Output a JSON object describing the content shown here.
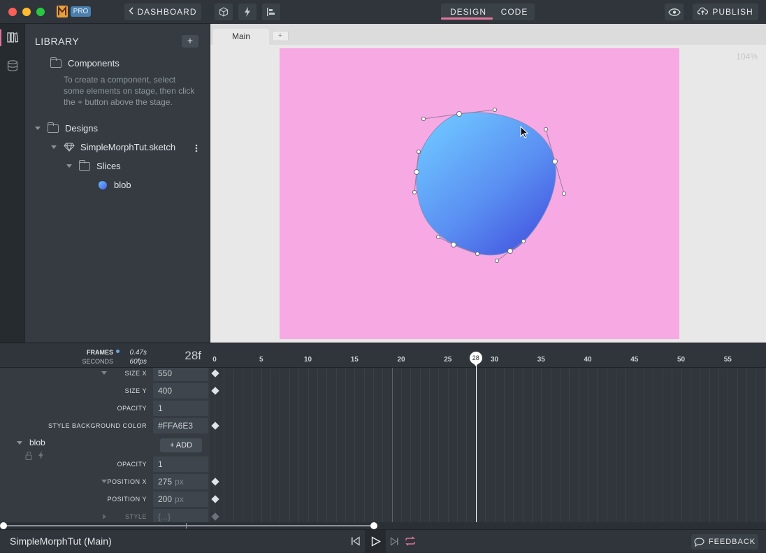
{
  "topbar": {
    "pro_badge": "PRO",
    "dashboard_label": "DASHBOARD",
    "design_tab": "DESIGN",
    "code_tab": "CODE",
    "publish_label": "PUBLISH",
    "icons": [
      "layers-icon",
      "database-icon",
      "cube-icon",
      "lightning-icon",
      "align-icon",
      "eye-icon",
      "upload-icon"
    ]
  },
  "library": {
    "title": "LIBRARY",
    "add_label": "+",
    "components_label": "Components",
    "components_hint": "To create a component, select some elements on stage, then click the + button above the stage.",
    "designs_label": "Designs",
    "sketch_file": "SimpleMorphTut.sketch",
    "slices_label": "Slices",
    "blob_label": "blob"
  },
  "canvas": {
    "tab_main": "Main",
    "tab_add": "+",
    "zoom": "104%",
    "artboard_color": "#f7a9e3"
  },
  "timeline": {
    "frames_label": "FRAMES",
    "seconds_label": "SECONDS",
    "time_seconds": "0.47s",
    "fps": "60fps",
    "current_frame": "28f",
    "playhead_frame": "28",
    "ticks": [
      "0",
      "5",
      "10",
      "15",
      "20",
      "25",
      "30",
      "35",
      "40",
      "45",
      "50",
      "55"
    ],
    "props": [
      {
        "label": "SIZE X",
        "value": "550",
        "unit": "",
        "keyframe": true,
        "caret": true
      },
      {
        "label": "SIZE Y",
        "value": "400",
        "unit": "",
        "keyframe": true,
        "caret": false
      },
      {
        "label": "OPACITY",
        "value": "1",
        "unit": "",
        "keyframe": false,
        "caret": false
      },
      {
        "label": "STYLE BACKGROUND COLOR",
        "value": "#FFA6E3",
        "unit": "",
        "keyframe": true,
        "caret": false
      }
    ],
    "layer_name": "blob",
    "add_button": "+ ADD",
    "blob_props": [
      {
        "label": "OPACITY",
        "value": "1",
        "unit": "",
        "keyframe": false,
        "caret": false
      },
      {
        "label": "POSITION X",
        "value": "275",
        "unit": "px",
        "keyframe": true,
        "caret": true
      },
      {
        "label": "POSITION Y",
        "value": "200",
        "unit": "px",
        "keyframe": true,
        "caret": false
      },
      {
        "label": "STYLE",
        "value": "{...}",
        "unit": "",
        "keyframe": true,
        "caret": true,
        "dim": true
      }
    ]
  },
  "status": {
    "document": "SimpleMorphTut (Main)",
    "feedback": "FEEDBACK"
  }
}
